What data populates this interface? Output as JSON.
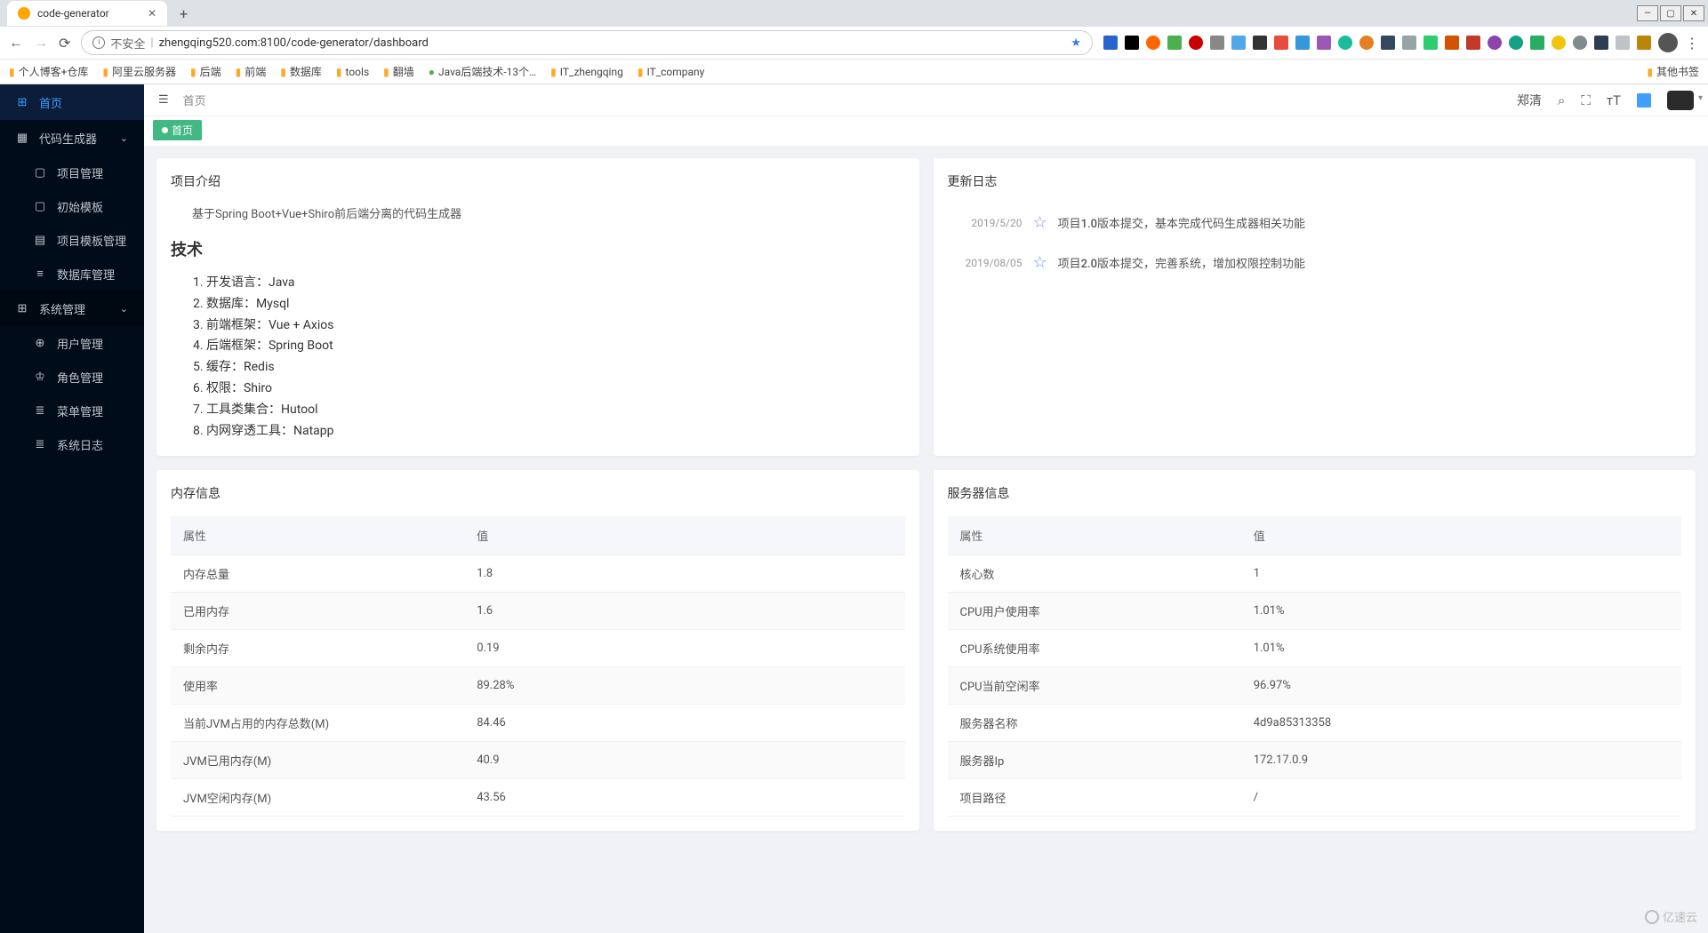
{
  "browser": {
    "tab_title": "code-generator",
    "address_warning": "不安全",
    "address_url": "zhengqing520.com:8100/code-generator/dashboard",
    "other_bookmarks": "其他书签"
  },
  "bookmarks": [
    "个人博客+仓库",
    "阿里云服务器",
    "后端",
    "前端",
    "数据库",
    "tools",
    "翻墙",
    "Java后端技术-13个…",
    "IT_zhengqing",
    "IT_company"
  ],
  "sidebar": {
    "items": [
      {
        "label": "首页",
        "icon": "⊞"
      },
      {
        "label": "代码生成器",
        "icon": "▦"
      },
      {
        "label": "项目管理",
        "icon": "▢"
      },
      {
        "label": "初始模板",
        "icon": "▢"
      },
      {
        "label": "项目模板管理",
        "icon": "▤"
      },
      {
        "label": "数据库管理",
        "icon": "≡"
      },
      {
        "label": "系统管理",
        "icon": "⊞"
      },
      {
        "label": "用户管理",
        "icon": "⊕"
      },
      {
        "label": "角色管理",
        "icon": "♔"
      },
      {
        "label": "菜单管理",
        "icon": "≣"
      },
      {
        "label": "系统日志",
        "icon": "≣"
      }
    ]
  },
  "header": {
    "breadcrumb": "首页",
    "user": "郑清",
    "tab_label": "首页"
  },
  "intro": {
    "title": "项目介绍",
    "text": "基于Spring Boot+Vue+Shiro前后端分离的代码生成器",
    "tech_heading": "技术",
    "tech_list": [
      "开发语言：Java",
      "数据库：Mysql",
      "前端框架：Vue + Axios",
      "后端框架：Spring Boot",
      "缓存：Redis",
      "权限：Shiro",
      "工具类集合：Hutool",
      "内网穿透工具：Natapp"
    ]
  },
  "changelog": {
    "title": "更新日志",
    "items": [
      {
        "date": "2019/5/20",
        "text": "项目1.0版本提交，基本完成代码生成器相关功能"
      },
      {
        "date": "2019/08/05",
        "text": "项目2.0版本提交，完善系统，增加权限控制功能"
      }
    ]
  },
  "memory": {
    "title": "内存信息",
    "col_attr": "属性",
    "col_val": "值",
    "rows": [
      {
        "attr": "内存总量",
        "val": "1.8"
      },
      {
        "attr": "已用内存",
        "val": "1.6"
      },
      {
        "attr": "剩余内存",
        "val": "0.19"
      },
      {
        "attr": "使用率",
        "val": "89.28%"
      },
      {
        "attr": "当前JVM占用的内存总数(M)",
        "val": "84.46"
      },
      {
        "attr": "JVM已用内存(M)",
        "val": "40.9"
      },
      {
        "attr": "JVM空闲内存(M)",
        "val": "43.56"
      }
    ]
  },
  "server": {
    "title": "服务器信息",
    "col_attr": "属性",
    "col_val": "值",
    "rows": [
      {
        "attr": "核心数",
        "val": "1"
      },
      {
        "attr": "CPU用户使用率",
        "val": "1.01%"
      },
      {
        "attr": "CPU系统使用率",
        "val": "1.01%"
      },
      {
        "attr": "CPU当前空闲率",
        "val": "96.97%"
      },
      {
        "attr": "服务器名称",
        "val": "4d9a85313358"
      },
      {
        "attr": "服务器Ip",
        "val": "172.17.0.9"
      },
      {
        "attr": "项目路径",
        "val": "/"
      }
    ]
  },
  "watermark": "亿速云"
}
